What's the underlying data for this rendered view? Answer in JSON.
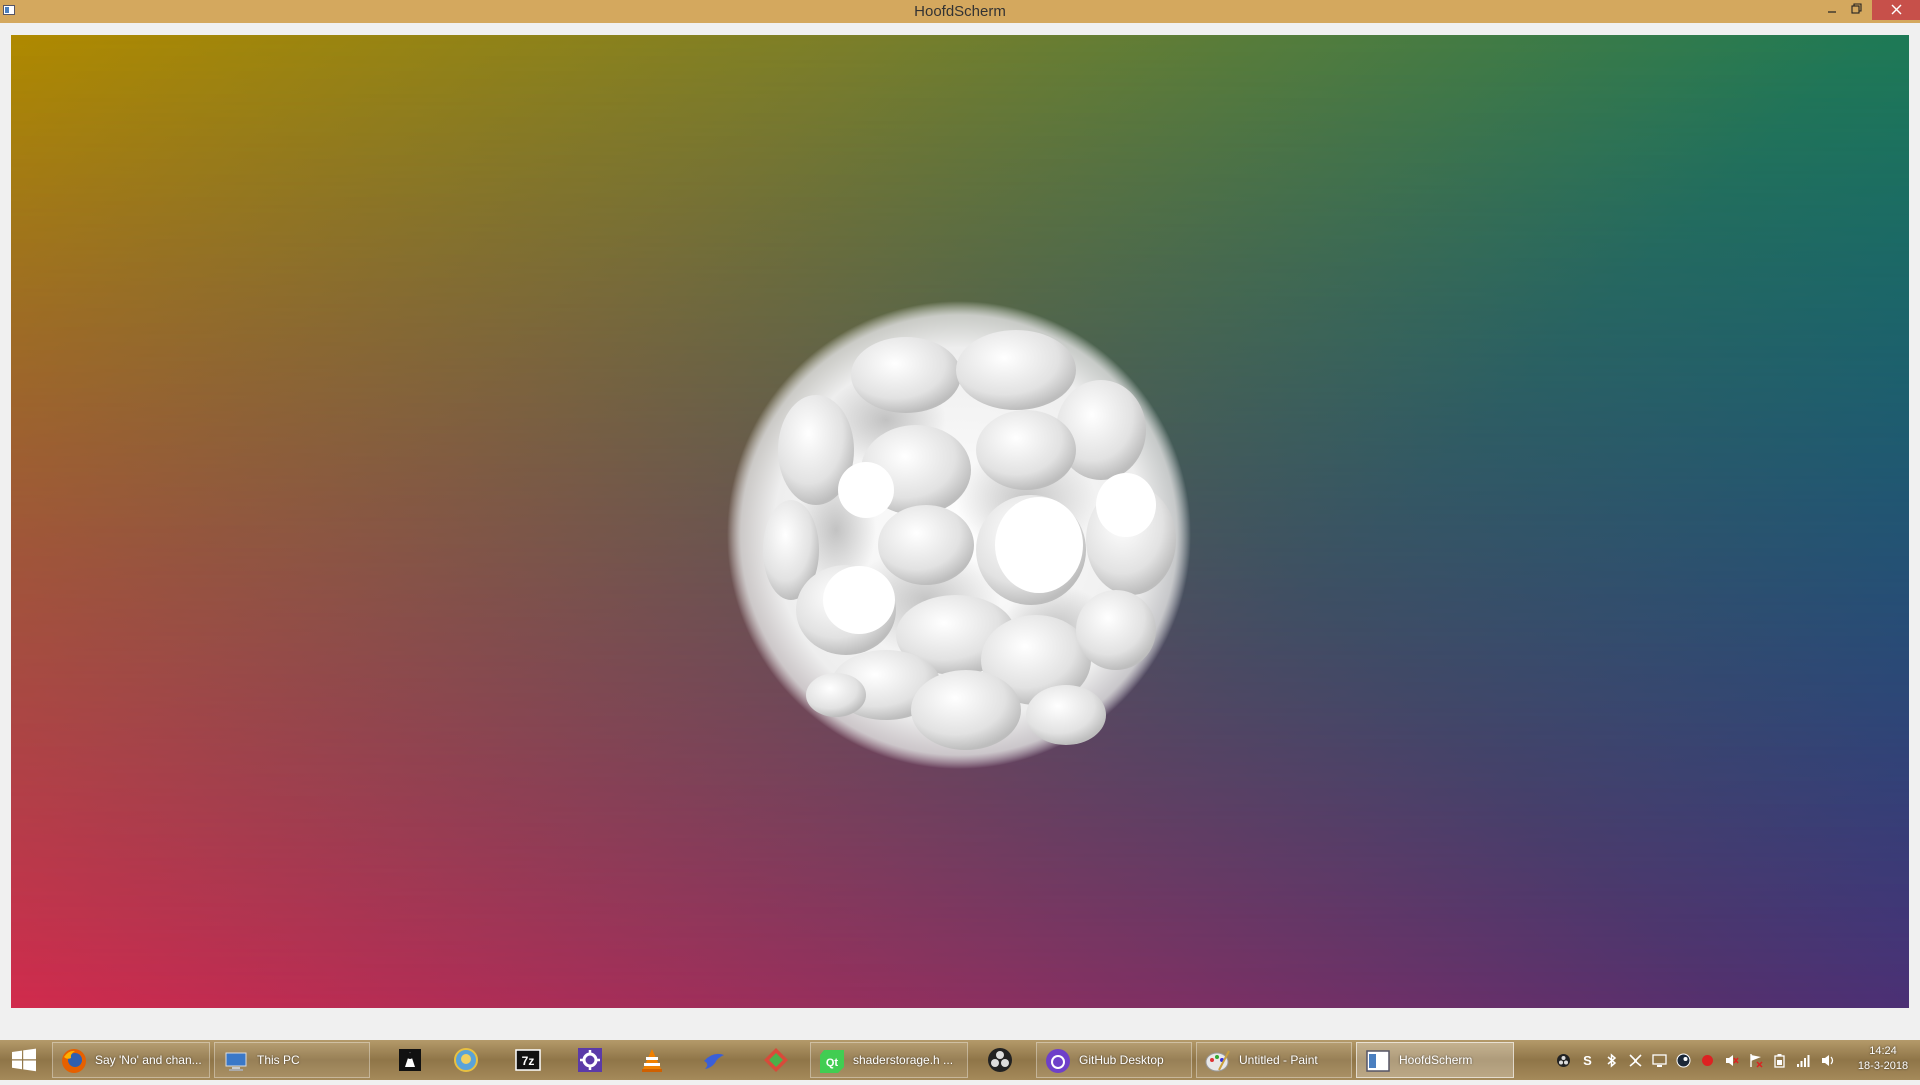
{
  "window": {
    "title": "HoofdScherm",
    "minimize_icon": "minimize-icon",
    "maximize_icon": "restore-icon",
    "close_icon": "close-icon"
  },
  "canvas": {
    "background_top_left": "#b08a00",
    "background_top_right": "#007a6a",
    "background_bottom_left": "#d12b4d",
    "background_bottom_right": "#1d2e99",
    "object": "white-blob-sphere"
  },
  "taskbar": {
    "start_icon": "windows-logo-icon",
    "items": [
      {
        "label": "Say 'No' and chan...",
        "icon": "firefox-icon"
      },
      {
        "label": "This PC",
        "icon": "this-pc-icon"
      },
      {
        "label": "",
        "icon": "inkscape-icon"
      },
      {
        "label": "",
        "icon": "fiddler-icon"
      },
      {
        "label": "",
        "icon": "7zip-icon"
      },
      {
        "label": "",
        "icon": "gear-icon"
      },
      {
        "label": "",
        "icon": "vlc-icon"
      },
      {
        "label": "",
        "icon": "bird-icon"
      },
      {
        "label": "",
        "icon": "git-gui-icon"
      },
      {
        "label": "shaderstorage.h ...",
        "icon": "qt-creator-icon"
      },
      {
        "label": "",
        "icon": "obs-icon"
      },
      {
        "label": "GitHub Desktop",
        "icon": "github-icon"
      },
      {
        "label": "Untitled - Paint",
        "icon": "paint-icon"
      },
      {
        "label": "HoofdScherm",
        "icon": "hoofdscherm-icon"
      }
    ],
    "tray_icons": [
      "obs-tray-icon",
      "skype-tray-icon",
      "bluetooth-tray-icon",
      "dev-tray-icon",
      "monitor-tray-icon",
      "steam-tray-icon",
      "red-tray-icon",
      "volume-mute-tray-icon",
      "flag-tray-icon",
      "battery-tray-icon",
      "network-tray-icon",
      "speaker-tray-icon"
    ],
    "clock": {
      "time": "14:24",
      "date": "18-3-2018"
    }
  }
}
